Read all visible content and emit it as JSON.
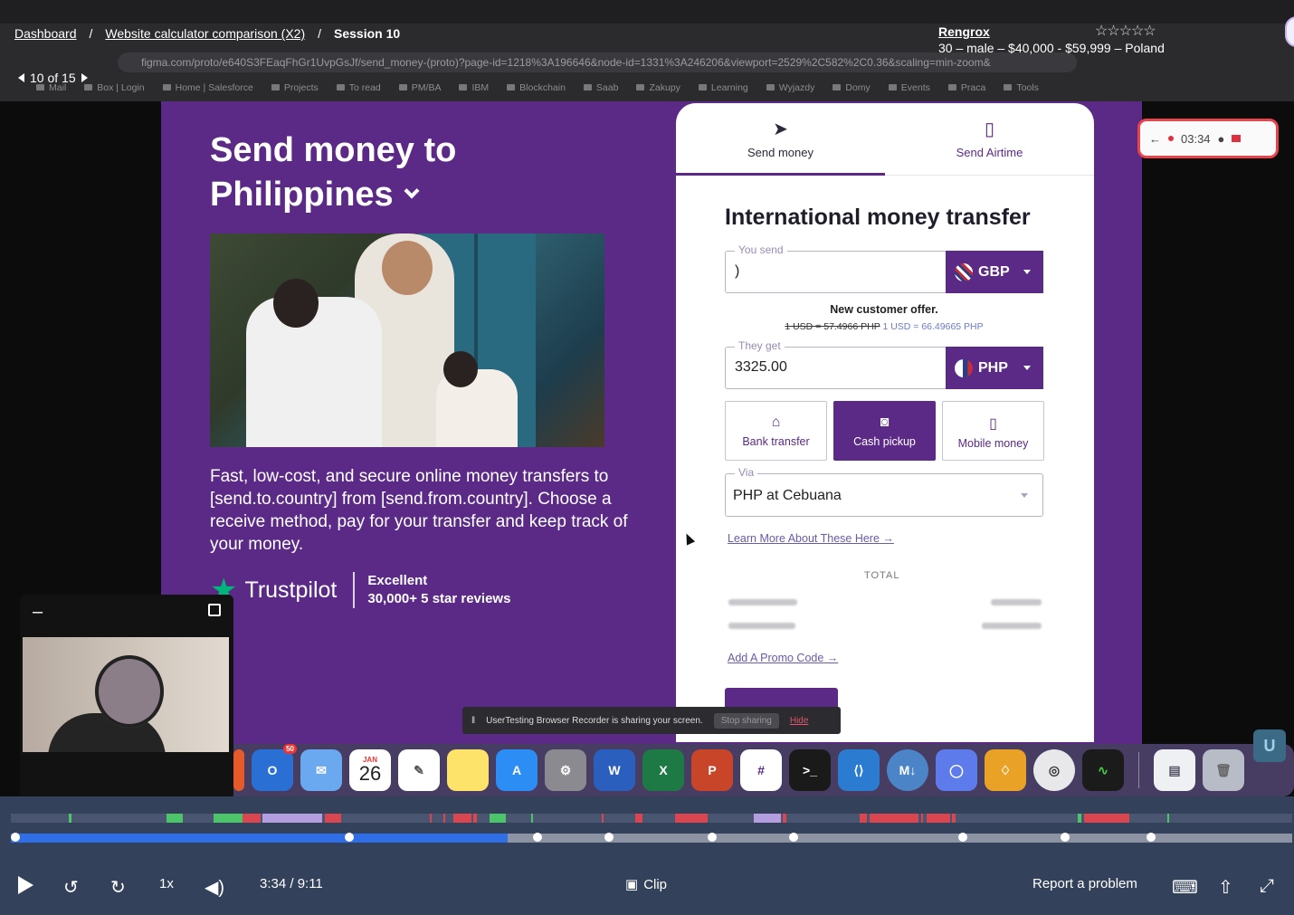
{
  "breadcrumb": {
    "dashboard": "Dashboard",
    "sep": "/",
    "study": "Website calculator comparison (X2)",
    "session": "Session 10"
  },
  "tester": {
    "name": "Rengrox",
    "details": "30 – male – $40,000 - $59,999 – Poland",
    "rating_stars": "☆☆☆☆☆"
  },
  "pager": {
    "text": "10 of 15"
  },
  "browser": {
    "url": "figma.com/proto/e640S3FEaqFhGr1UvpGsJf/send_money-(proto)?page-id=1218%3A196646&node-id=1331%3A246206&viewport=2529%2C582%2C0.36&scaling=min-zoom&",
    "bookmarks": [
      "Mail",
      "Box | Login",
      "Home | Salesforce",
      "Projects",
      "To read",
      "PM/BA",
      "IBM",
      "Blockchain",
      "Saab",
      "Zakupy",
      "Learning",
      "Wyjazdy",
      "Domy",
      "Events",
      "Praca",
      "Tools"
    ]
  },
  "hero": {
    "title_line1": "Send money to",
    "title_line2": "Philippines",
    "description": "Fast, low-cost, and secure online money transfers to [send.to.country] from [send.from.country]. Choose a receive method, pay for your transfer and keep track of your money.",
    "trustpilot": "Trustpilot",
    "rating_word": "Excellent",
    "reviews": "30,000+ 5 star reviews"
  },
  "calculator": {
    "tabs": [
      {
        "label": "Send money",
        "icon": "paper-plane-icon"
      },
      {
        "label": "Send Airtime",
        "icon": "phone-icon"
      }
    ],
    "title": "International money transfer",
    "send_label": "You send",
    "send_value": ")",
    "send_currency": "GBP",
    "offer_heading": "New customer offer.",
    "old_rate": "1 USD = 57.4966 PHP",
    "new_rate": "1 USD = 66.49665 PHP",
    "get_label": "They get",
    "get_value": "3325.00",
    "get_currency": "PHP",
    "methods": [
      {
        "label": "Bank transfer",
        "icon": "bank-icon"
      },
      {
        "label": "Cash pickup",
        "icon": "cash-icon"
      },
      {
        "label": "Mobile money",
        "icon": "mobile-icon"
      }
    ],
    "via_label": "Via",
    "via_value": "PHP at Cebuana",
    "learn_more": "Learn More About These Here",
    "total_label": "TOTAL",
    "promo": "Add A Promo Code"
  },
  "recorder": {
    "time": "03:34"
  },
  "share_bar": {
    "message": "UserTesting Browser Recorder is sharing your screen.",
    "stop": "Stop sharing",
    "hide": "Hide"
  },
  "dock": {
    "calendar_month": "JAN",
    "calendar_day": "26",
    "outlook_badge": "50"
  },
  "player": {
    "speed": "1x",
    "time": "3:34 / 9:11",
    "clip": "Clip",
    "report": "Report a problem",
    "progress_fraction": 0.388
  },
  "colors": {
    "brand_purple": "#5b2a86",
    "trustpilot_green": "#00b67a",
    "progress_blue": "#2f6ee6",
    "marker_green": "#4cc46a",
    "marker_red": "#d9464f",
    "marker_lilac": "#b59ee0"
  }
}
